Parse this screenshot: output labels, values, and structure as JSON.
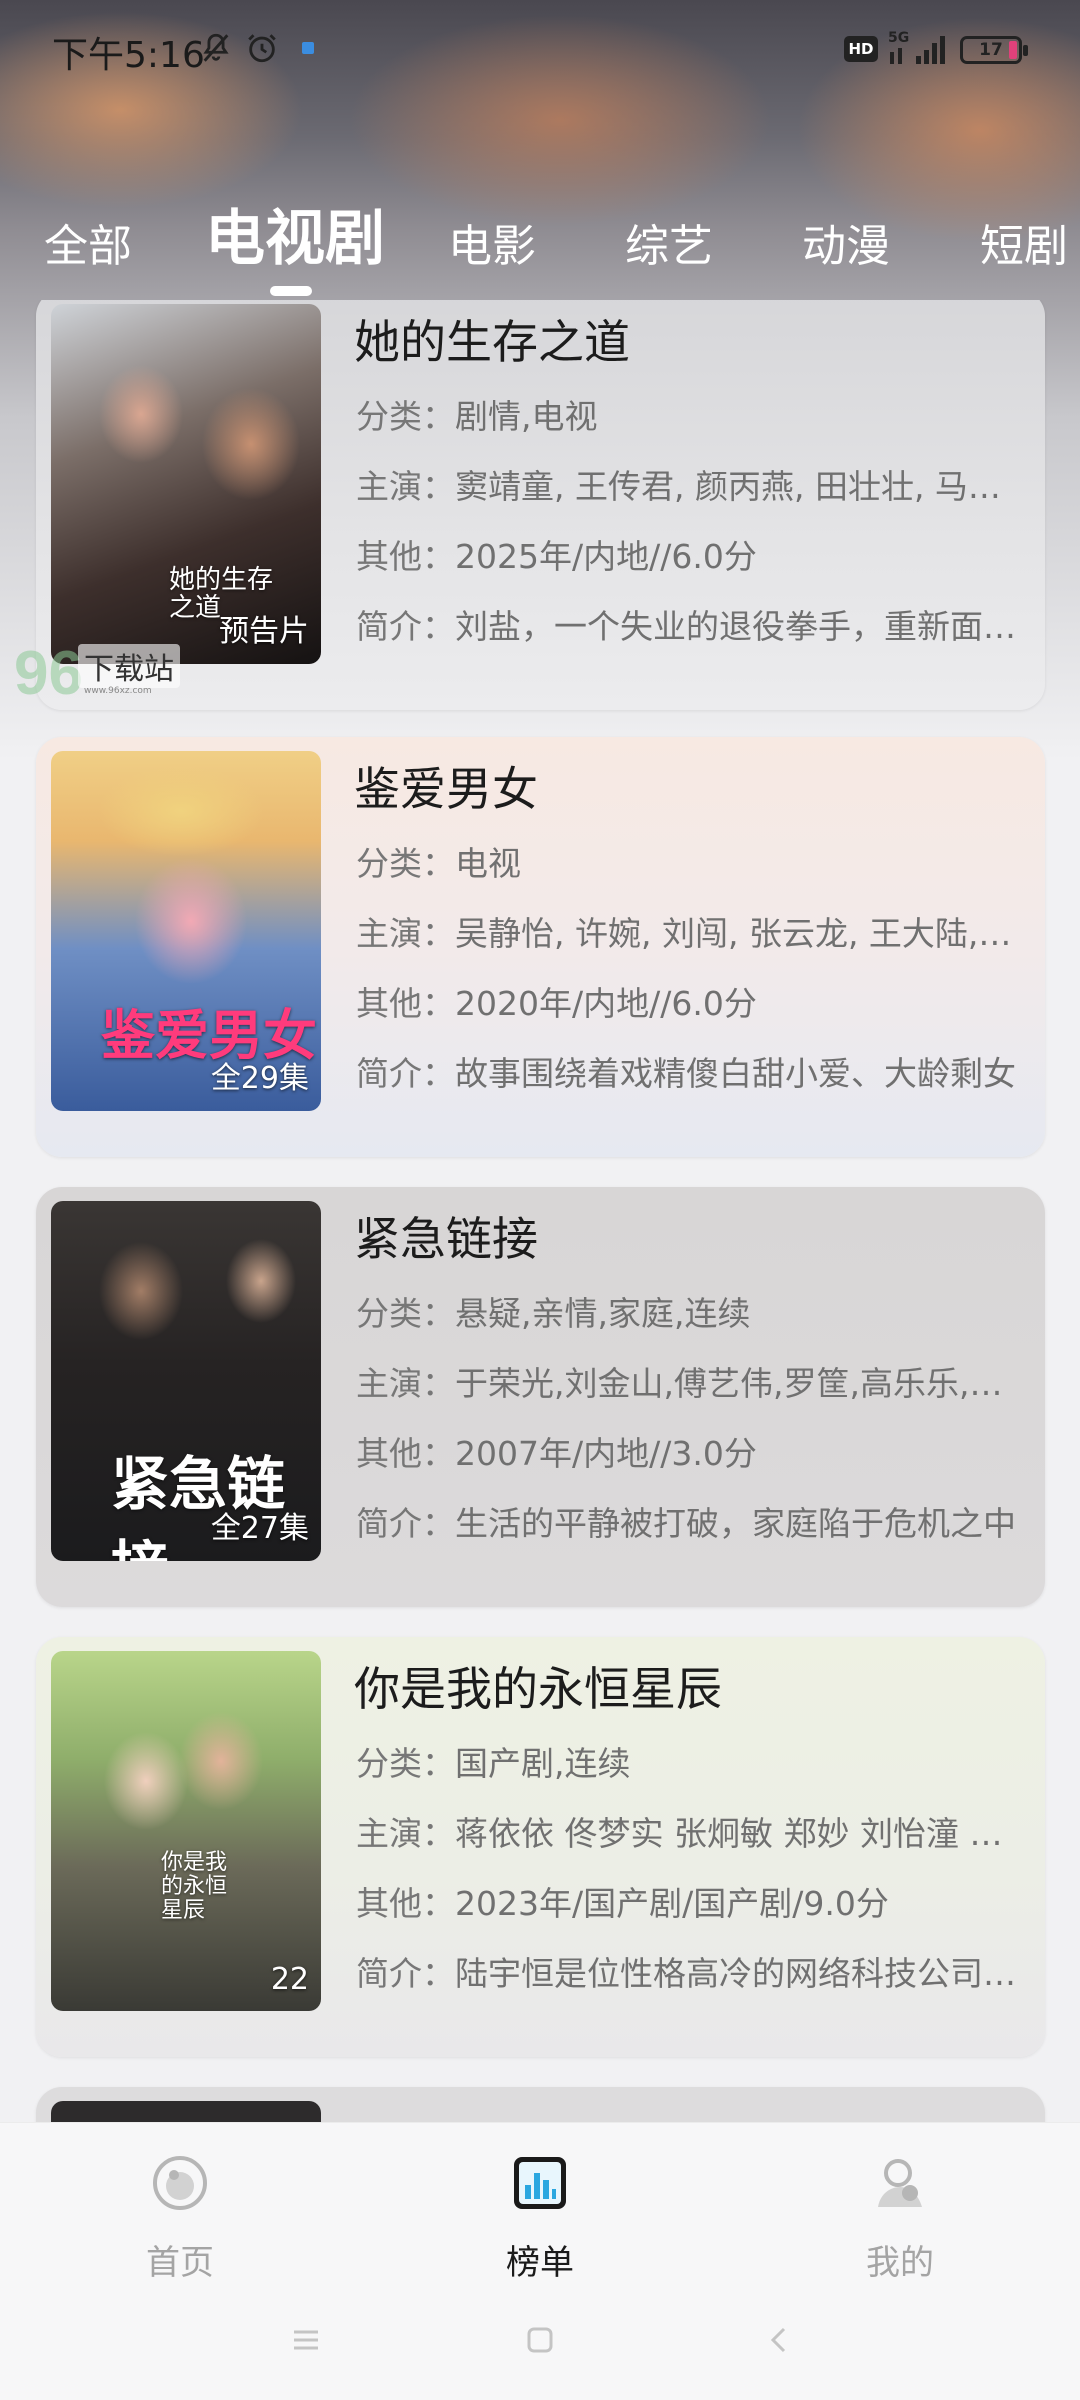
{
  "status_bar": {
    "time": "下午5:16",
    "icons": [
      "mute-bell-icon",
      "alarm-icon",
      "notification-dot-icon",
      "hd-icon",
      "5g-signal-icon",
      "battery-icon"
    ],
    "hd": "HD",
    "network": "5G",
    "battery": "17"
  },
  "tabs": [
    {
      "label": "全部",
      "active": false
    },
    {
      "label": "电视剧",
      "active": true
    },
    {
      "label": "电影",
      "active": false
    },
    {
      "label": "综艺",
      "active": false
    },
    {
      "label": "动漫",
      "active": false
    },
    {
      "label": "短剧",
      "active": false
    }
  ],
  "labels": {
    "category": "分类：",
    "cast": "主演：",
    "other": "其他：",
    "intro": "简介："
  },
  "items": [
    {
      "title": "她的生存之道",
      "category": "剧情,电视",
      "cast": "窦靖童, 王传君, 颜丙燕, 田壮壮, 马苏, 赵一博",
      "other": "2025年/内地//6.0分",
      "intro": "刘盐，一个失业的退役拳手，重新面对生活",
      "badge": "预告片",
      "poster_text": "她的生存之道"
    },
    {
      "title": "鉴爱男女",
      "category": "电视",
      "cast": "吴静怡, 许婉, 刘闯, 张云龙, 王大陆, 王佳",
      "other": "2020年/内地//6.0分",
      "intro": "故事围绕着戏精傻白甜小爱、大龄剩女",
      "badge": "全29集",
      "poster_text": "鉴爱男女"
    },
    {
      "title": "紧急链接",
      "category": "悬疑,亲情,家庭,连续",
      "cast": "于荣光,刘金山,傅艺伟,罗筐,高乐乐,张峰",
      "other": "2007年/内地//3.0分",
      "intro": "生活的平静被打破，家庭陷于危机之中",
      "badge": "全27集",
      "poster_text": "紧急链接"
    },
    {
      "title": "你是我的永恒星辰",
      "category": "国产剧,连续",
      "cast": "蒋依依 佟梦实 张炯敏 郑妙 刘怡潼 王以纶",
      "other": "2023年/国产剧/国产剧/9.0分",
      "intro": "陆宇恒是位性格高冷的网络科技公司总裁",
      "badge": "22",
      "poster_text": "你是我的永恒星辰"
    }
  ],
  "watermark": {
    "logo": "96",
    "text": "下载站",
    "url": "www.96xz.com"
  },
  "bottom_nav": [
    {
      "label": "首页",
      "icon": "home-icon",
      "active": false
    },
    {
      "label": "榜单",
      "icon": "ranking-chart-icon",
      "active": true
    },
    {
      "label": "我的",
      "icon": "profile-icon",
      "active": false
    }
  ],
  "system_nav": [
    "menu-icon",
    "home-square-icon",
    "back-icon"
  ],
  "colors": {
    "accent_active_nav": "#1b1b1b",
    "inactive_nav": "#a4a4a4",
    "ranking_icon_blue": "#2aa7e0",
    "meta_text": "#707070"
  }
}
